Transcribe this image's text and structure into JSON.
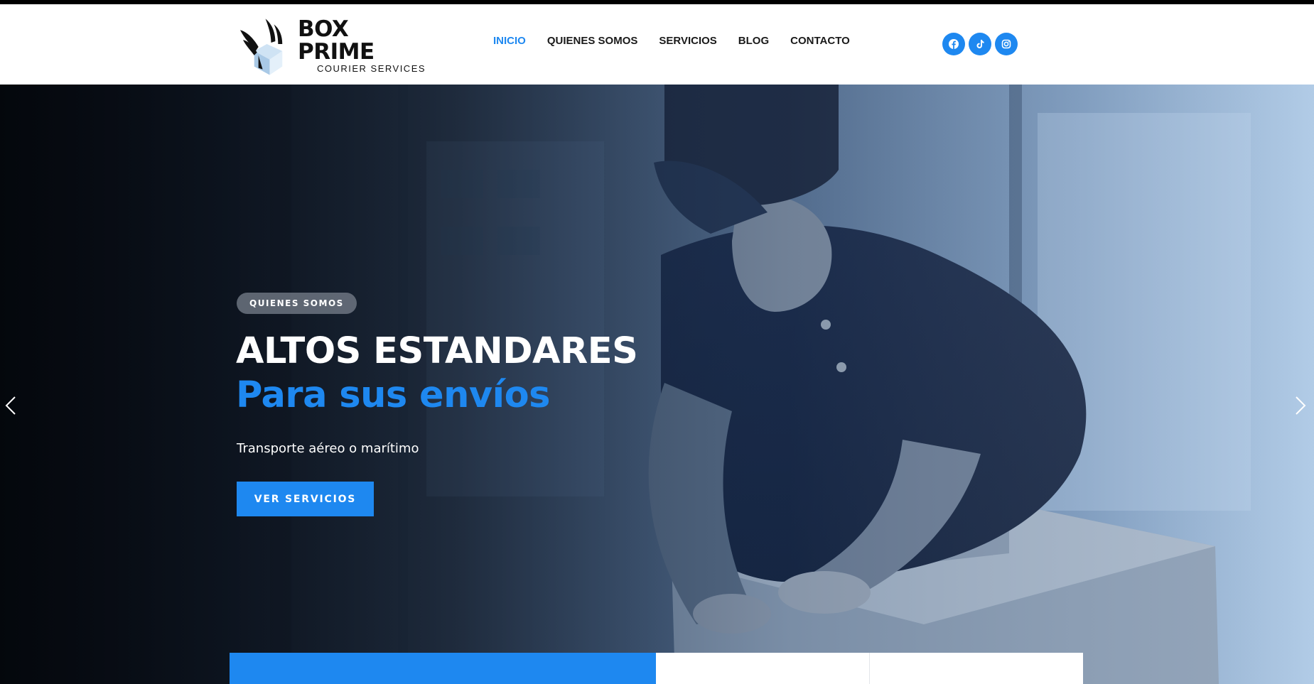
{
  "brand": {
    "name": "BOX PRIME",
    "tagline": "COURIER SERVICES"
  },
  "nav": {
    "items": [
      {
        "label": "INICIO",
        "active": true
      },
      {
        "label": "QUIENES SOMOS",
        "active": false
      },
      {
        "label": "SERVICIOS",
        "active": false
      },
      {
        "label": "BLOG",
        "active": false
      },
      {
        "label": "CONTACTO",
        "active": false
      }
    ]
  },
  "socials": [
    "facebook-icon",
    "tiktok-icon",
    "instagram-icon"
  ],
  "hero": {
    "badge": "QUIENES SOMOS",
    "title_line1": "ALTOS ESTANDARES",
    "title_line2": "Para sus envíos",
    "description": "Transporte aéreo o marítimo",
    "cta_label": "VER SERVICIOS"
  },
  "colors": {
    "accent": "#1e88f0",
    "text_dark": "#1a1a1a",
    "top_bar": "#000000"
  }
}
